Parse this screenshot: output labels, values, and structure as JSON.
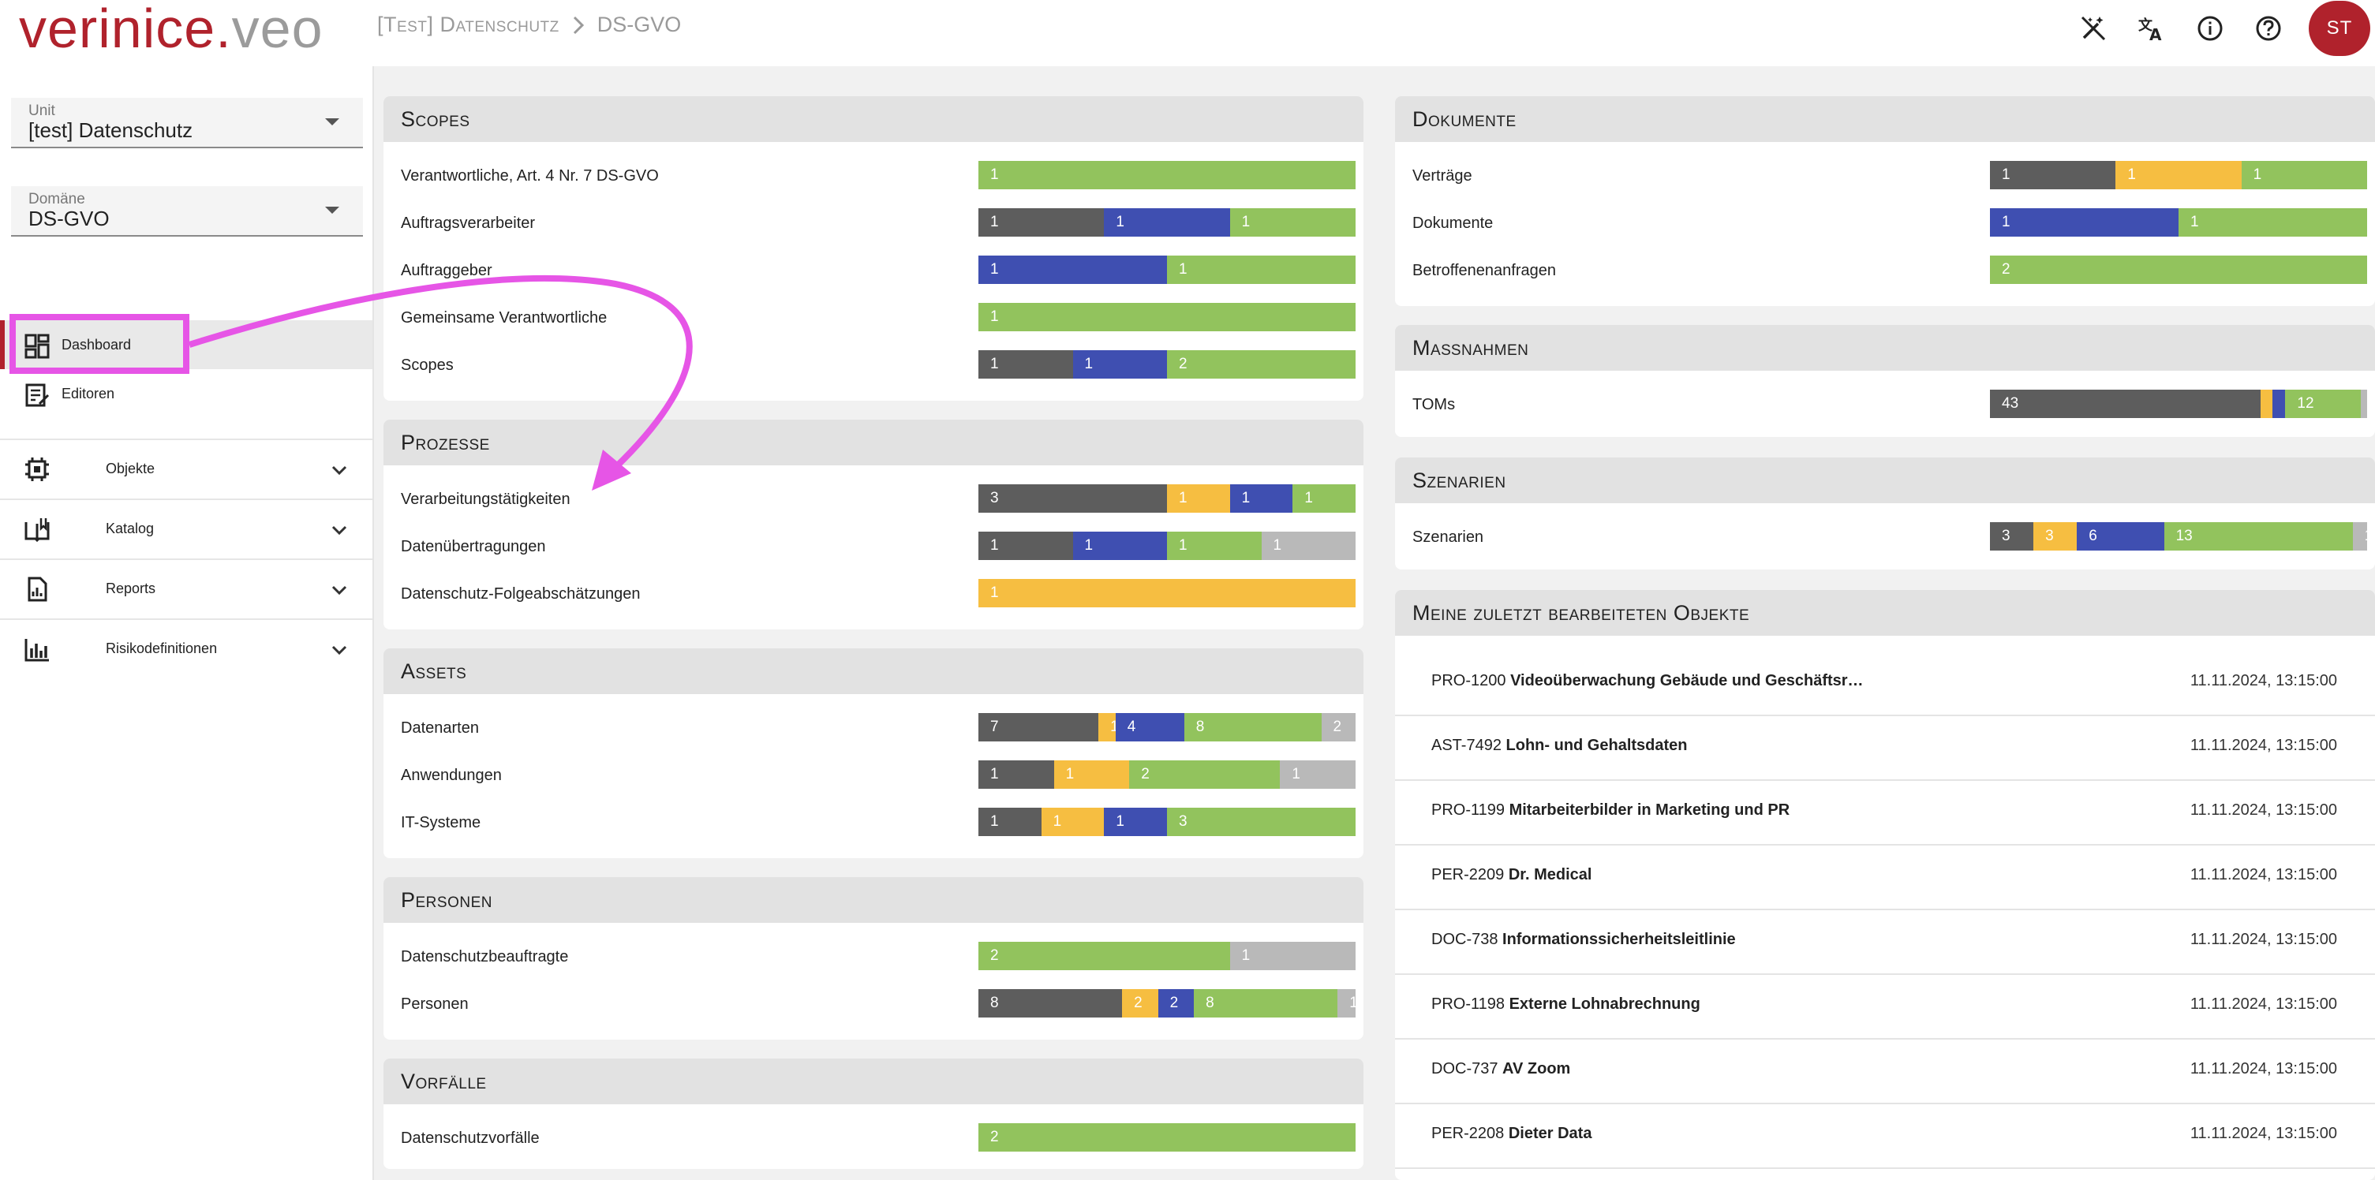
{
  "topbar": {
    "logo_part1": "verinice",
    "logo_dot": ".",
    "logo_part2": "veo",
    "breadcrumb_unit": "[Test] Datenschutz",
    "breadcrumb_domain": "DS-GVO",
    "avatar_initials": "ST",
    "icons": [
      "magic-off-icon",
      "translate-icon",
      "info-icon",
      "help-icon"
    ]
  },
  "sidebar": {
    "unit_label": "Unit",
    "unit_value": "[test] Datenschutz",
    "domain_label": "Domäne",
    "domain_value": "DS-GVO",
    "nav": [
      {
        "label": "Dashboard",
        "icon": "dashboard-icon",
        "active": true
      },
      {
        "label": "Editoren",
        "icon": "editor-icon",
        "active": false
      }
    ],
    "groups": [
      {
        "label": "Objekte",
        "icon": "objects-icon"
      },
      {
        "label": "Katalog",
        "icon": "catalog-icon"
      },
      {
        "label": "Reports",
        "icon": "reports-icon"
      },
      {
        "label": "Risikodefinitionen",
        "icon": "chart-icon"
      }
    ]
  },
  "colors": {
    "grey": "#5d5d5d",
    "yellow": "#f6be41",
    "blue": "#3f4fb1",
    "green": "#92c35d",
    "light": "#b9b9b9",
    "brand": "#b0222c",
    "annotation": "#e655e6"
  },
  "cards": {
    "scopes": {
      "title": "Scopes",
      "rows": [
        {
          "label": "Verantwortliche, Art. 4 Nr. 7 DS-GVO",
          "segments": [
            {
              "c": "green",
              "n": "1"
            }
          ]
        },
        {
          "label": "Auftragsverarbeiter",
          "segments": [
            {
              "c": "grey",
              "n": "1"
            },
            {
              "c": "blue",
              "n": "1"
            },
            {
              "c": "green",
              "n": "1"
            }
          ]
        },
        {
          "label": "Auftraggeber",
          "segments": [
            {
              "c": "blue",
              "n": "1"
            },
            {
              "c": "green",
              "n": "1"
            }
          ]
        },
        {
          "label": "Gemeinsame Verantwortliche",
          "segments": [
            {
              "c": "green",
              "n": "1"
            }
          ]
        },
        {
          "label": "Scopes",
          "segments": [
            {
              "c": "grey",
              "n": "1"
            },
            {
              "c": "blue",
              "n": "1"
            },
            {
              "c": "green",
              "n": "2"
            }
          ]
        }
      ]
    },
    "prozesse": {
      "title": "Prozesse",
      "rows": [
        {
          "label": "Verarbeitungstätigkeiten",
          "segments": [
            {
              "c": "grey",
              "n": "3"
            },
            {
              "c": "yellow",
              "n": "1"
            },
            {
              "c": "blue",
              "n": "1"
            },
            {
              "c": "green",
              "n": "1"
            }
          ]
        },
        {
          "label": "Datenübertragungen",
          "segments": [
            {
              "c": "grey",
              "n": "1"
            },
            {
              "c": "blue",
              "n": "1"
            },
            {
              "c": "green",
              "n": "1"
            },
            {
              "c": "light",
              "n": "1"
            }
          ]
        },
        {
          "label": "Datenschutz-Folgeabschätzungen",
          "segments": [
            {
              "c": "yellow",
              "n": "1"
            }
          ]
        }
      ]
    },
    "assets": {
      "title": "Assets",
      "rows": [
        {
          "label": "Datenarten",
          "segments": [
            {
              "c": "grey",
              "n": "7"
            },
            {
              "c": "yellow",
              "n": "1"
            },
            {
              "c": "blue",
              "n": "4"
            },
            {
              "c": "green",
              "n": "8"
            },
            {
              "c": "light",
              "n": "2"
            }
          ]
        },
        {
          "label": "Anwendungen",
          "segments": [
            {
              "c": "grey",
              "n": "1"
            },
            {
              "c": "yellow",
              "n": "1"
            },
            {
              "c": "green",
              "n": "2"
            },
            {
              "c": "light",
              "n": "1"
            }
          ]
        },
        {
          "label": "IT-Systeme",
          "segments": [
            {
              "c": "grey",
              "n": "1"
            },
            {
              "c": "yellow",
              "n": "1"
            },
            {
              "c": "blue",
              "n": "1"
            },
            {
              "c": "green",
              "n": "3"
            }
          ]
        }
      ]
    },
    "personen": {
      "title": "Personen",
      "rows": [
        {
          "label": "Datenschutzbeauftragte",
          "segments": [
            {
              "c": "green",
              "n": "2"
            },
            {
              "c": "light",
              "n": "1"
            }
          ]
        },
        {
          "label": "Personen",
          "segments": [
            {
              "c": "grey",
              "n": "8"
            },
            {
              "c": "yellow",
              "n": "2"
            },
            {
              "c": "blue",
              "n": "2"
            },
            {
              "c": "green",
              "n": "8"
            },
            {
              "c": "light",
              "n": "1"
            }
          ]
        }
      ]
    },
    "vorfaelle": {
      "title": "Vorfälle",
      "rows": [
        {
          "label": "Datenschutzvorfälle",
          "segments": [
            {
              "c": "green",
              "n": "2"
            }
          ]
        }
      ]
    },
    "dokumente": {
      "title": "Dokumente",
      "rows": [
        {
          "label": "Verträge",
          "segments": [
            {
              "c": "grey",
              "n": "1"
            },
            {
              "c": "yellow",
              "n": "1"
            },
            {
              "c": "green",
              "n": "1"
            }
          ]
        },
        {
          "label": "Dokumente",
          "segments": [
            {
              "c": "blue",
              "n": "1"
            },
            {
              "c": "green",
              "n": "1"
            }
          ]
        },
        {
          "label": "Betroffenenanfragen",
          "segments": [
            {
              "c": "green",
              "n": "2"
            }
          ]
        }
      ]
    },
    "massnahmen": {
      "title": "Maßnahmen",
      "rows": [
        {
          "label": "TOMs",
          "segments": [
            {
              "c": "grey",
              "n": "43"
            },
            {
              "c": "yellow",
              "n": "2"
            },
            {
              "c": "blue",
              "n": "2"
            },
            {
              "c": "green",
              "n": "12"
            },
            {
              "c": "light",
              "n": "1"
            }
          ]
        }
      ]
    },
    "szenarien": {
      "title": "Szenarien",
      "rows": [
        {
          "label": "Szenarien",
          "segments": [
            {
              "c": "grey",
              "n": "3"
            },
            {
              "c": "yellow",
              "n": "3"
            },
            {
              "c": "blue",
              "n": "6"
            },
            {
              "c": "green",
              "n": "13"
            },
            {
              "c": "light",
              "n": "1"
            }
          ]
        }
      ]
    }
  },
  "recent": {
    "title": "Meine zuletzt bearbeiteten Objekte",
    "items": [
      {
        "id": "PRO-1200",
        "name": "Videoüberwachung Gebäude und Geschäftsr…",
        "date": "11.11.2024, 13:15:00"
      },
      {
        "id": "AST-7492",
        "name": "Lohn- und Gehaltsdaten",
        "date": "11.11.2024, 13:15:00"
      },
      {
        "id": "PRO-1199",
        "name": "Mitarbeiterbilder in Marketing und PR",
        "date": "11.11.2024, 13:15:00"
      },
      {
        "id": "PER-2209",
        "name": "Dr. Medical",
        "date": "11.11.2024, 13:15:00"
      },
      {
        "id": "DOC-738",
        "name": "Informationssicherheitsleitlinie",
        "date": "11.11.2024, 13:15:00"
      },
      {
        "id": "PRO-1198",
        "name": "Externe Lohnabrechnung",
        "date": "11.11.2024, 13:15:00"
      },
      {
        "id": "DOC-737",
        "name": "AV Zoom",
        "date": "11.11.2024, 13:15:00"
      },
      {
        "id": "PER-2208",
        "name": "Dieter Data",
        "date": "11.11.2024, 13:15:00"
      }
    ]
  }
}
